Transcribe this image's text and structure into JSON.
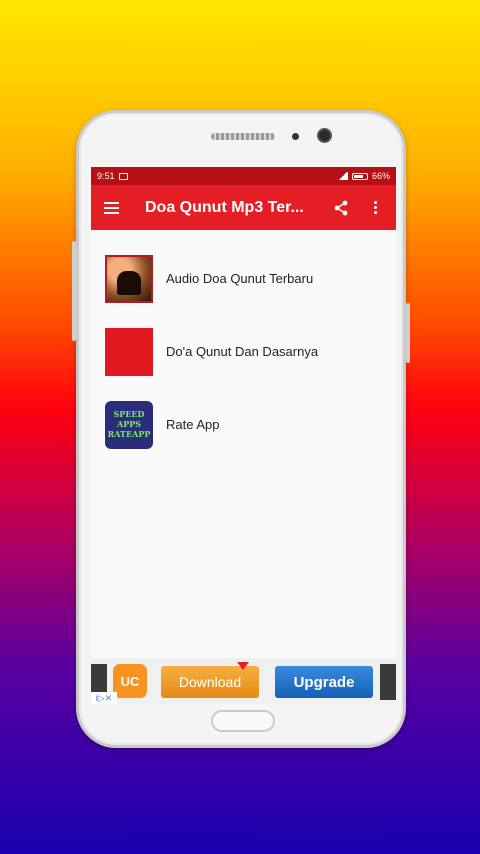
{
  "status_bar": {
    "time": "9:51",
    "battery": "66%"
  },
  "app_bar": {
    "title": "Doa Qunut Mp3 Ter..."
  },
  "list": {
    "items": [
      {
        "label": "Audio Doa Qunut Terbaru",
        "icon": "audio-thumbnail"
      },
      {
        "label": "Do'a Qunut Dan Dasarnya",
        "icon": "red-square-thumbnail"
      },
      {
        "label": "Rate App",
        "icon": "rate-app-thumbnail",
        "thumb_text": [
          "SPEED",
          "APPS",
          "RATEAPP"
        ]
      }
    ]
  },
  "ad": {
    "download_label": "Download",
    "upgrade_label": "Upgrade",
    "logo_text": "UC",
    "choices_text": "i▷✕"
  },
  "colors": {
    "primary": "#e51d24",
    "status_bar": "#b80f14"
  }
}
